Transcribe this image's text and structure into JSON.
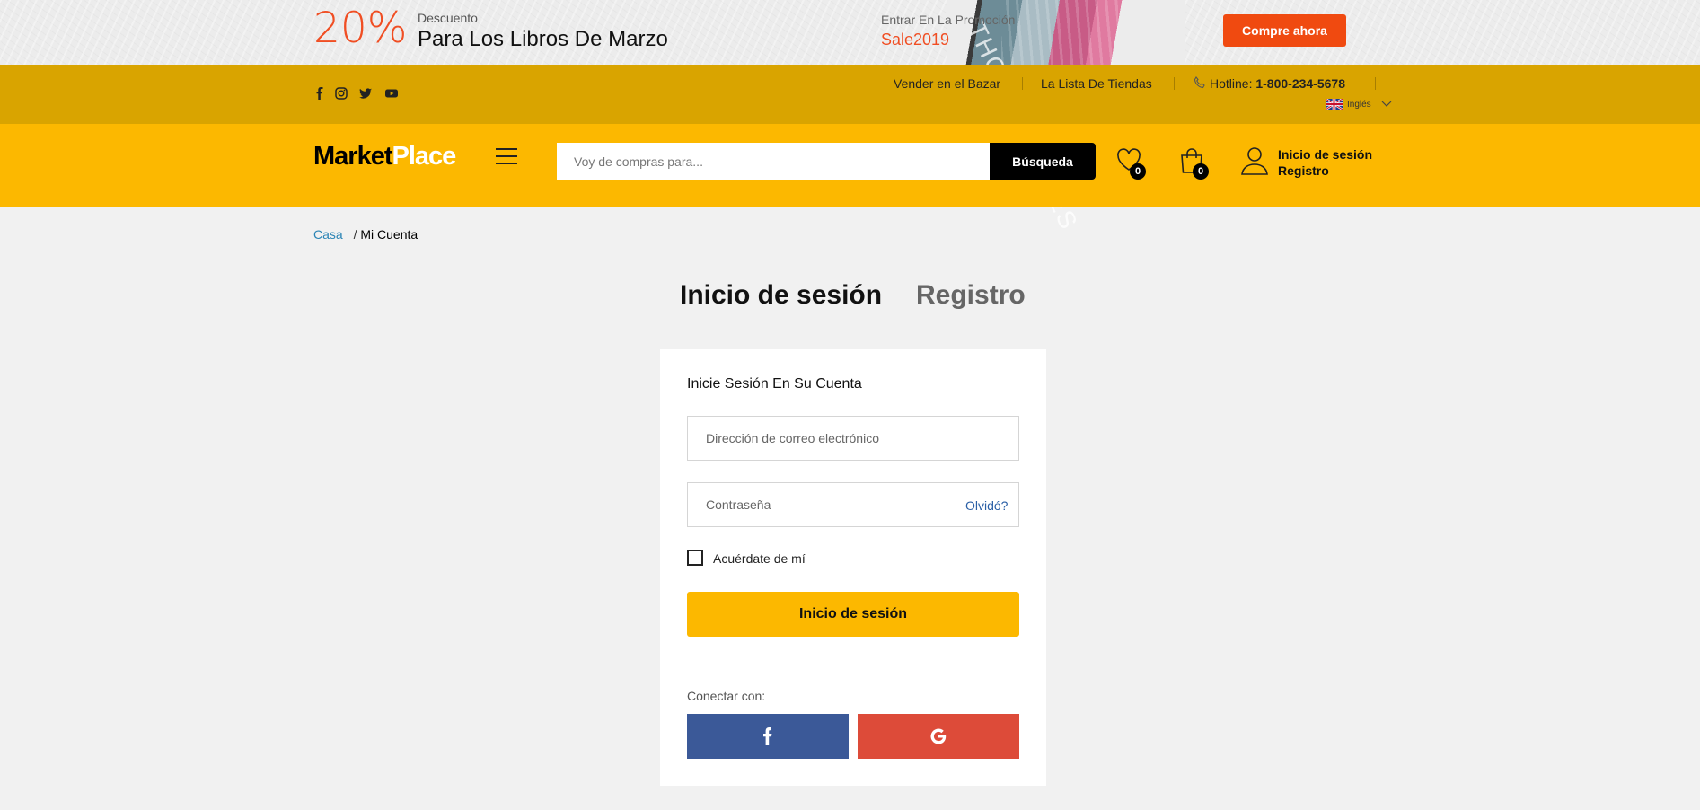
{
  "promo": {
    "percent": "20%",
    "subtitle": "Descuento",
    "title": "Para Los Libros De Marzo",
    "enter_text": "Entrar En La Promoción",
    "code": "Sale2019",
    "book_text": "THOUSA PIECES",
    "cta": "Compre ahora"
  },
  "topbar": {
    "social": [
      "facebook-icon",
      "instagram-icon",
      "twitter-icon",
      "youtube-icon"
    ],
    "sell": "Vender en el Bazar",
    "stores": "La Lista De Tiendas",
    "hotline_label": "Hotline:",
    "hotline_number": "1-800-234-5678",
    "language": "Inglés"
  },
  "header": {
    "logo_a": "Market",
    "logo_b": "Place",
    "search_placeholder": "Voy de compras para...",
    "search_button": "Búsqueda",
    "wishlist_count": "0",
    "cart_count": "0",
    "login": "Inicio de sesión",
    "register": "Registro"
  },
  "breadcrumb": {
    "home": "Casa",
    "separator": "/",
    "current": "Mi Cuenta"
  },
  "tabs": {
    "login": "Inicio de sesión",
    "register": "Registro"
  },
  "form": {
    "title": "Inicie Sesión En Su Cuenta",
    "email_placeholder": "Dirección de correo electrónico",
    "password_placeholder": "Contraseña",
    "forgot": "Olvidó?",
    "remember": "Acuérdate de mí",
    "submit": "Inicio de sesión",
    "connect_label": "Conectar con:"
  },
  "colors": {
    "accent": "#fcb800",
    "topbar": "#d9a400",
    "promo_orange": "#f04a10",
    "facebook": "#3b5998",
    "google": "#dd4b39"
  }
}
